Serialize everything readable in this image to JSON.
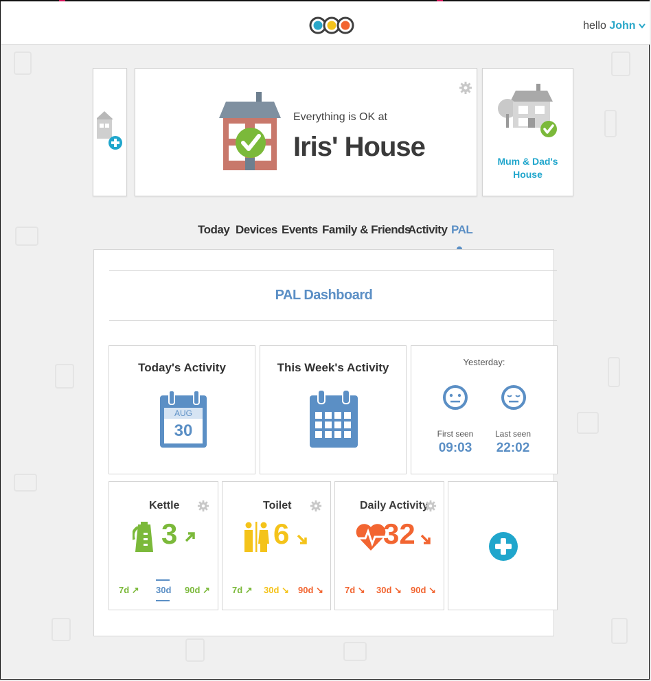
{
  "header": {
    "greeting": "hello",
    "user_name": "John",
    "chevron": "chevron-down-icon"
  },
  "houses": {
    "add": {
      "icon": "add-house-icon"
    },
    "current": {
      "status": "Everything is OK at",
      "name": "Iris' House",
      "icon": "house-ok-icon"
    },
    "other": {
      "name_line1": "Mum & Dad's",
      "name_line2": "House",
      "icon": "house-ok-icon"
    }
  },
  "tabs": [
    "Today",
    "Devices",
    "Events",
    "Family & Friends",
    "Activity",
    "PAL"
  ],
  "active_tab": "PAL",
  "dashboard": {
    "title": "PAL Dashboard",
    "today": {
      "title": "Today's Activity",
      "month": "AUG",
      "day": "30"
    },
    "week": {
      "title": "This Week's Activity"
    },
    "yesterday": {
      "label": "Yesterday:",
      "first_label": "First seen",
      "first_time": "09:03",
      "last_label": "Last seen",
      "last_time": "22:02"
    },
    "metrics": [
      {
        "title": "Kettle",
        "value": "3",
        "trend": "up",
        "color": "#7bb93a",
        "periods": [
          {
            "label": "7d",
            "trend": "up"
          },
          {
            "label": "30d",
            "trend": "selected"
          },
          {
            "label": "90d",
            "trend": "up"
          }
        ]
      },
      {
        "title": "Toilet",
        "value": "6",
        "trend": "down",
        "color": "#f4c31a",
        "periods": [
          {
            "label": "7d",
            "trend": "up"
          },
          {
            "label": "30d",
            "trend": "down"
          },
          {
            "label": "90d",
            "trend": "down"
          }
        ]
      },
      {
        "title": "Daily Activity",
        "value": "32",
        "trend": "down",
        "color": "#f26531",
        "periods": [
          {
            "label": "7d",
            "trend": "down"
          },
          {
            "label": "30d",
            "trend": "down"
          },
          {
            "label": "90d",
            "trend": "down"
          }
        ]
      }
    ],
    "colors": {
      "green": "#7bb93a",
      "yellow": "#f4c31a",
      "orange": "#f26531",
      "blue": "#5b8fc5",
      "teal": "#20a6cc"
    }
  }
}
